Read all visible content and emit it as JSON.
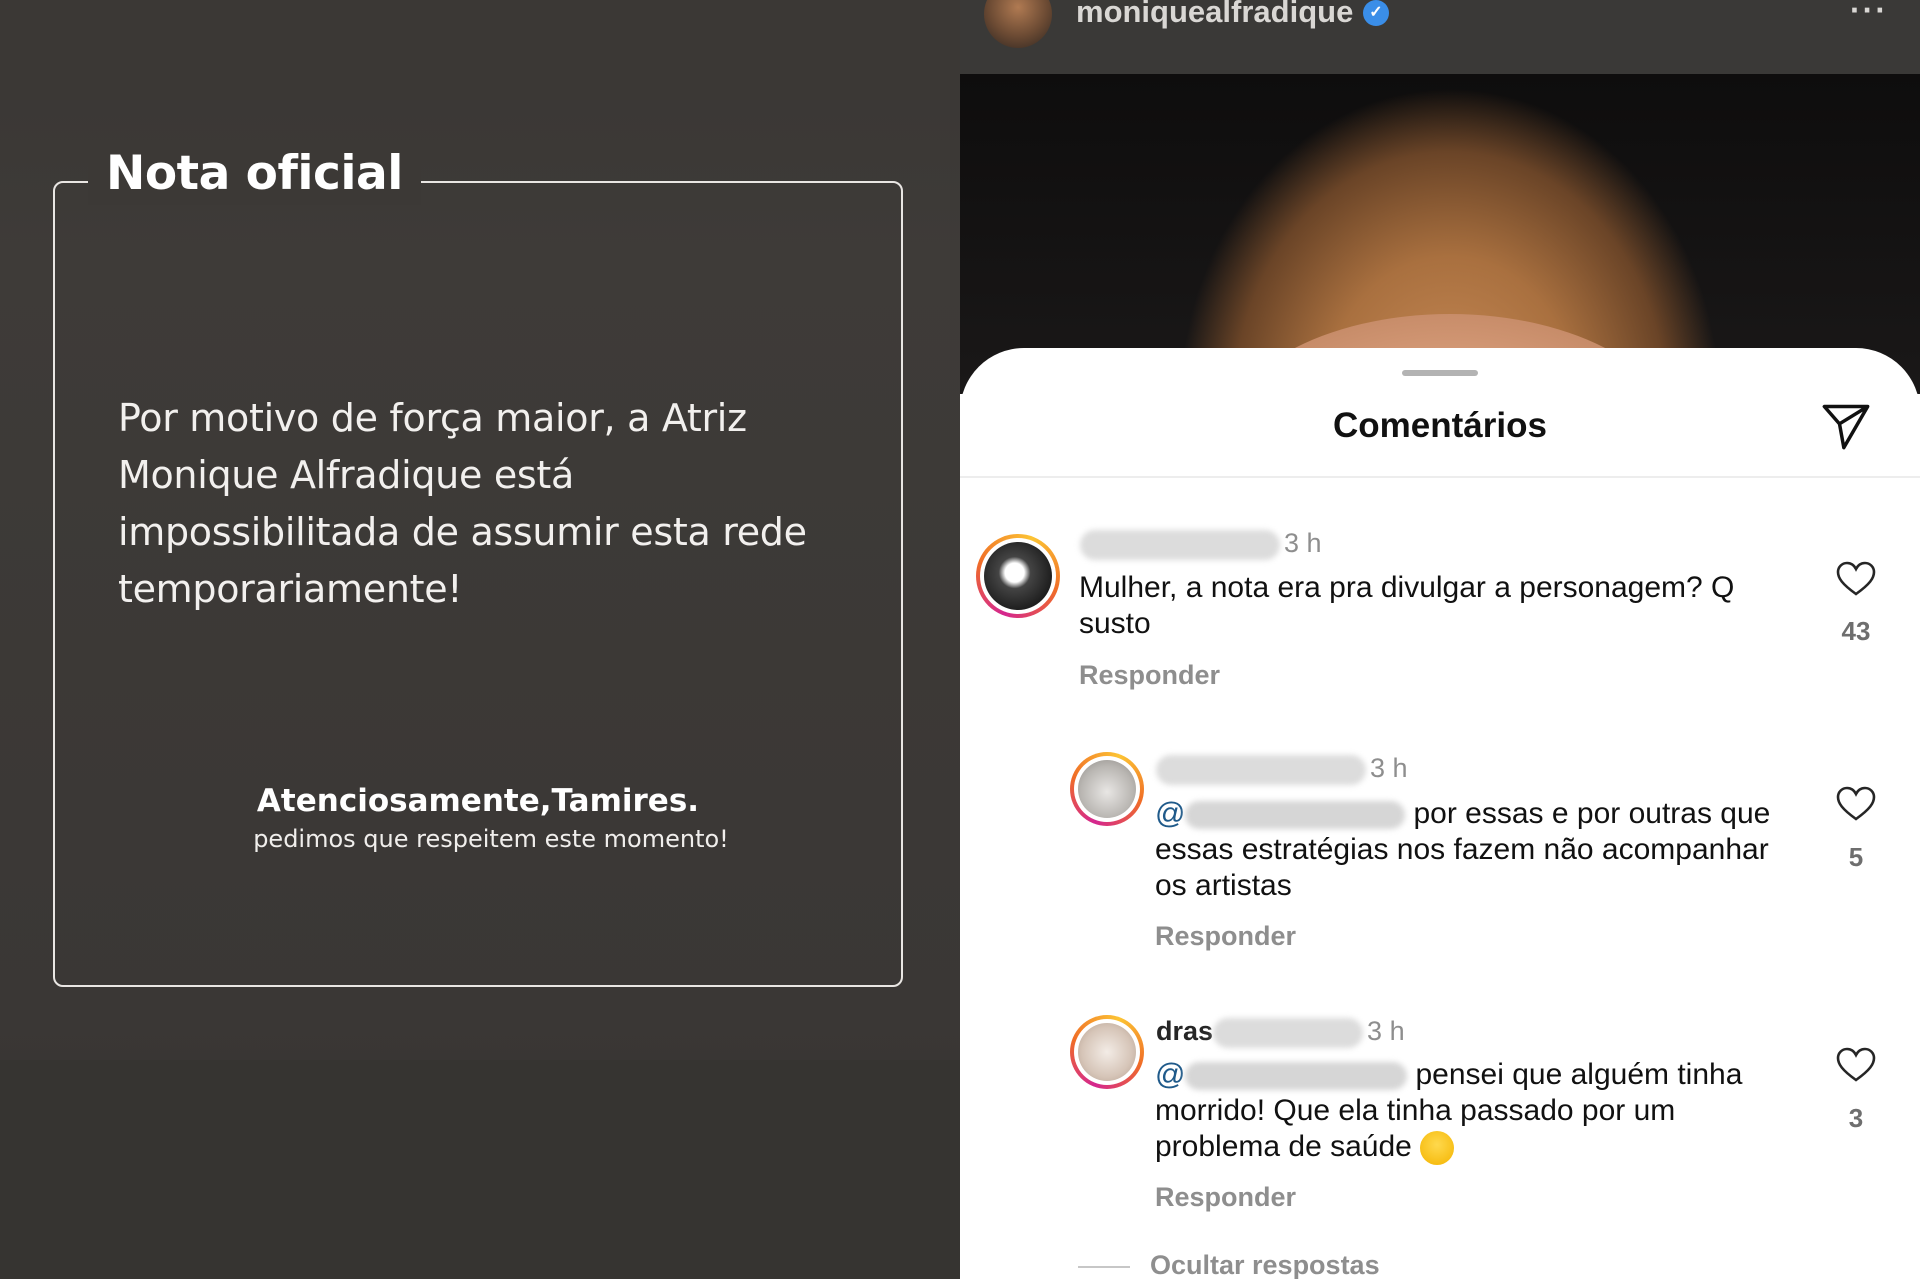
{
  "story": {
    "title": "Nota oficial",
    "body": "Por motivo de força maior, a Atriz Monique Alfradique está impossibilitada de assumir esta rede temporariamente!",
    "signature": "Atenciosamente,Tamires.",
    "signature_sub": "pedimos que respeitem este momento!"
  },
  "post": {
    "username": "moniquealfradique",
    "verified_icon": "verified-badge-icon",
    "more_icon": "more-options-icon"
  },
  "comments_sheet": {
    "title": "Comentários",
    "send_icon": "send-icon",
    "hide_replies": "Ocultar respostas"
  },
  "comments": [
    {
      "time": "3 h",
      "text": "Mulher, a nota era pra divulgar a personagem? Q susto",
      "reply": "Responder",
      "likes": "43"
    },
    {
      "time": "3 h",
      "mention_start": "@",
      "text": "por essas e por outras que essas estratégias nos fazem não acompanhar os artistas",
      "reply": "Responder",
      "likes": "5"
    },
    {
      "time": "3 h",
      "name_partial": "dras",
      "mention_start": "@",
      "text": "pensei que alguém tinha morrido! Que ela tinha passado por um problema de saúde",
      "reply": "Responder",
      "likes": "3"
    }
  ],
  "colors": {
    "story_bg": "#3c3936",
    "mention": "#1f5a8a",
    "muted": "#8e8e8e",
    "verified": "#3a8ee8"
  }
}
